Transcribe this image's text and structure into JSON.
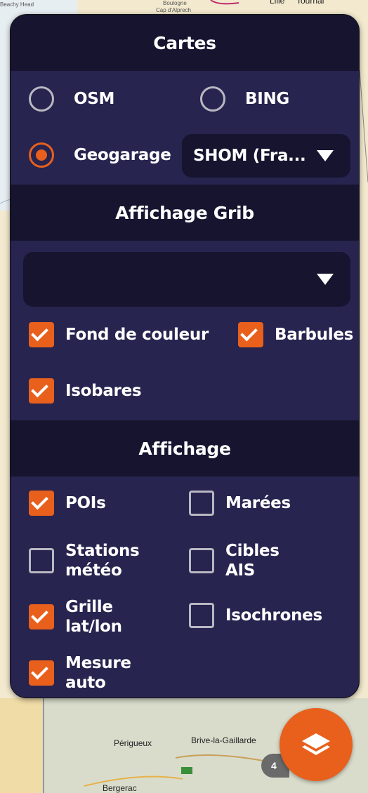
{
  "map": {
    "labels": {
      "boulogne": "Boulogne",
      "cap": "Cap d'Alprech",
      "lille": "Lille",
      "tournai": "Tournai",
      "beachy": "Beachy Head",
      "perigueux": "Périgueux",
      "brive": "Brive-la-Gaillarde",
      "bergerac": "Bergerac",
      "zoom": "4"
    }
  },
  "panel": {
    "cartes": {
      "title": "Cartes",
      "osm_label": "OSM",
      "bing_label": "BING",
      "geogarage_label": "Geogarage",
      "geogarage_select_value": "SHOM (Fra...",
      "selected": "Geogarage"
    },
    "grib": {
      "title": "Affichage Grib",
      "select_value": "",
      "options": [
        {
          "label": "Fond de couleur",
          "checked": true
        },
        {
          "label": "Barbules",
          "checked": true
        },
        {
          "label": "Isobares",
          "checked": true
        }
      ]
    },
    "affichage": {
      "title": "Affichage",
      "options": [
        {
          "label": "POIs",
          "checked": true
        },
        {
          "label": "Marées",
          "checked": false
        },
        {
          "label": "Stations météo",
          "line1": "Stations",
          "line2": "météo",
          "checked": false
        },
        {
          "label": "Cibles AIS",
          "line1": "Cibles",
          "line2": "AIS",
          "checked": false
        },
        {
          "label": "Grille lat/lon",
          "line1": "Grille",
          "line2": "lat/lon",
          "checked": true
        },
        {
          "label": "Isochrones",
          "checked": false
        },
        {
          "label": "Mesure auto",
          "line1": "Mesure",
          "line2": "auto",
          "checked": true
        }
      ]
    }
  },
  "fab": {
    "icon": "layers-icon"
  },
  "colors": {
    "accent": "#e8601c",
    "panel_bg": "#27244f",
    "header_bg": "#16142f",
    "unchecked_border": "#b8b8c2"
  }
}
